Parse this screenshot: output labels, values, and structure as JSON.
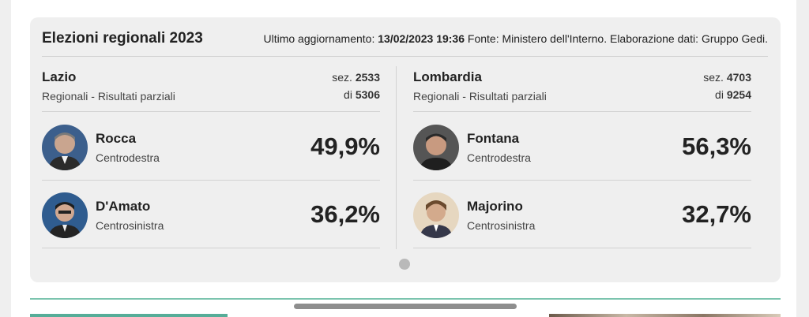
{
  "header": {
    "title": "Elezioni regionali 2023",
    "update_label": "Ultimo aggiornamento:",
    "update_value": "13/02/2023 19:36",
    "source": "Fonte: Ministero dell'Interno. Elaborazione dati: Gruppo Gedi."
  },
  "regions": [
    {
      "name": "Lazio",
      "subtitle": "Regionali - Risultati parziali",
      "sez_label": "sez.",
      "sez_value": "2533",
      "di_label": "di",
      "di_value": "5306",
      "candidates": [
        {
          "name": "Rocca",
          "party": "Centrodestra",
          "pct": "49,9%"
        },
        {
          "name": "D'Amato",
          "party": "Centrosinistra",
          "pct": "36,2%"
        }
      ]
    },
    {
      "name": "Lombardia",
      "subtitle": "Regionali - Risultati parziali",
      "sez_label": "sez.",
      "sez_value": "4703",
      "di_label": "di",
      "di_value": "9254",
      "candidates": [
        {
          "name": "Fontana",
          "party": "Centrodestra",
          "pct": "56,3%"
        },
        {
          "name": "Majorino",
          "party": "Centrosinistra",
          "pct": "32,7%"
        }
      ]
    }
  ],
  "colors": {
    "card_bg": "#efefef",
    "accent_teal": "#7bc4ae"
  }
}
